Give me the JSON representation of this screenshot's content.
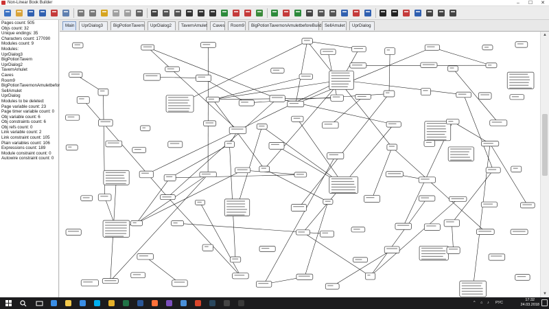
{
  "window": {
    "title": "Non-Linear Book Builder",
    "minimize": "–",
    "maximize": "☐",
    "close": "✕"
  },
  "toolbar": {
    "buttons": [
      {
        "name": "new-project-button",
        "icon": "new-page-icon",
        "color": "#3c73c4"
      },
      {
        "name": "open-project-button",
        "icon": "open-folder-icon",
        "color": "#d9a43b"
      },
      {
        "name": "save-button",
        "icon": "floppy-icon",
        "color": "#3060b0"
      },
      {
        "name": "save-as-button",
        "icon": "floppy-pen-icon",
        "color": "#3060b0"
      },
      {
        "name": "export-button",
        "icon": "grid-export-icon",
        "color": "#c43a3a"
      },
      {
        "name": "close-project-button",
        "icon": "close-doc-icon",
        "color": "#6080b0"
      },
      {
        "name": "undo-button",
        "icon": "undo-icon",
        "color": "#7a7a7a"
      },
      {
        "name": "redo-button",
        "icon": "redo-icon",
        "color": "#7a7a7a"
      },
      {
        "name": "cut-button",
        "icon": "cut-icon",
        "color": "#d6a41f"
      },
      {
        "name": "copy-button",
        "icon": "copy-icon",
        "color": "#a0a0a0"
      },
      {
        "name": "paste-button",
        "icon": "paste-icon",
        "color": "#a0a0a0"
      },
      {
        "name": "clipboard-button",
        "icon": "clipboard-icon",
        "color": "#666"
      },
      {
        "name": "link-button",
        "icon": "link-icon",
        "color": "#444"
      },
      {
        "name": "page-button",
        "icon": "page-icon",
        "color": "#555"
      },
      {
        "name": "folder-up-button",
        "icon": "folder-up-icon",
        "color": "#555"
      },
      {
        "name": "arrow-tool-button",
        "icon": "arrow-down-right-icon",
        "color": "#333"
      },
      {
        "name": "select-tool-button",
        "icon": "square-icon",
        "color": "#333"
      },
      {
        "name": "crop-button",
        "icon": "crop-icon",
        "color": "#333"
      },
      {
        "name": "edit-button",
        "icon": "pencil-icon",
        "color": "#2c8a3b"
      },
      {
        "name": "image-button",
        "icon": "image-icon",
        "color": "#c53a3a"
      },
      {
        "name": "delete-button",
        "icon": "delete-icon",
        "color": "#c53a3a"
      },
      {
        "name": "grid-button",
        "icon": "grid-icon",
        "color": "#3a8a3a"
      },
      {
        "name": "run-button",
        "icon": "run-icon",
        "color": "#2c8a3b"
      },
      {
        "name": "magnet-button",
        "icon": "magnet-icon",
        "color": "#c53a3a"
      },
      {
        "name": "check-button",
        "icon": "check-icon",
        "color": "#2c8a3b"
      },
      {
        "name": "window-button",
        "icon": "window-icon",
        "color": "#444"
      },
      {
        "name": "preview-button",
        "icon": "preview-icon",
        "color": "#555"
      },
      {
        "name": "layers-button",
        "icon": "layers-icon",
        "color": "#555"
      },
      {
        "name": "monitor-button",
        "icon": "monitor-icon",
        "color": "#3060b0"
      },
      {
        "name": "module-button",
        "icon": "module-icon",
        "color": "#c53a3a"
      },
      {
        "name": "module-save-button",
        "icon": "module-save-icon",
        "color": "#3060b0"
      },
      {
        "name": "print-button",
        "icon": "print-icon",
        "color": "#222"
      },
      {
        "name": "camera-button",
        "icon": "camera-icon",
        "color": "#222"
      },
      {
        "name": "settings-button",
        "icon": "settings-icon",
        "color": "#c53a3a"
      },
      {
        "name": "variables-button",
        "icon": "variables-icon",
        "color": "#3060b0"
      },
      {
        "name": "user-button",
        "icon": "user-settings-icon",
        "color": "#444"
      },
      {
        "name": "terminal-button",
        "icon": "terminal-icon",
        "color": "#444"
      },
      {
        "name": "text-button",
        "icon": "text-icon",
        "color": "#444"
      }
    ]
  },
  "info": {
    "lines": [
      "Pages count: 505",
      "Objs count: 32",
      "Unique endings: 35",
      "Characters count: 177090",
      "Modules count: 9",
      "Modules:",
      "UprDialog3",
      "BigPotionTavern",
      "UprDialog2",
      "TavernAmulet",
      "Caves",
      "Room9",
      "BigPotionTavernonAmuletbefore",
      "SellAmulet",
      "UprDialog",
      "Modules to be deleted:",
      "Page variable count: 23",
      "Page timer variable count: 0",
      "Obj variable count: 6",
      "Obj constraints count: 6",
      "Obj refs count: 0",
      "Link variable count: 2",
      "Link constraint count: 105",
      "Plain variables count: 106",
      "Expressions count: 189",
      "Module constraint count: 0",
      "Autowire constraint count: 0"
    ]
  },
  "tabs": [
    "Main",
    "UprDialog3",
    "BigPotionTavern",
    "UprDialog2",
    "TavernAmulet",
    "Caves",
    "Room9",
    "BigPotionTavernonAmuletbeforeBuild",
    "SellAmulet",
    "UprDialog"
  ],
  "active_tab": "Main",
  "scroll": {
    "up": "▲",
    "down": "▼"
  },
  "taskbar": {
    "apps": [
      {
        "name": "start-button",
        "icon": "windows-icon",
        "color": "#ffffff"
      },
      {
        "name": "search-taskbar",
        "icon": "search-icon",
        "color": "#ffffff"
      },
      {
        "name": "task-view-button",
        "icon": "task-view-icon",
        "color": "#ffffff"
      },
      {
        "name": "edge-app",
        "icon": "edge-icon",
        "color": "#3a8ee6"
      },
      {
        "name": "explorer-app",
        "icon": "folder-icon",
        "color": "#f2c94c"
      },
      {
        "name": "store-app",
        "icon": "store-icon",
        "color": "#3a8ee6"
      },
      {
        "name": "skype-app",
        "icon": "skype-icon",
        "color": "#00aff0"
      },
      {
        "name": "chrome-app",
        "icon": "chrome-icon",
        "color": "#e5b12a"
      },
      {
        "name": "excel-app",
        "icon": "excel-icon",
        "color": "#217346"
      },
      {
        "name": "word-app",
        "icon": "word-icon",
        "color": "#2b5797"
      },
      {
        "name": "firefox-app",
        "icon": "firefox-icon",
        "color": "#ff7139"
      },
      {
        "name": "visual-studio-app",
        "icon": "visual-studio-icon",
        "color": "#7b4fbd"
      },
      {
        "name": "app-blue",
        "icon": "app-icon",
        "color": "#4a90d9"
      },
      {
        "name": "java-app",
        "icon": "java-icon",
        "color": "#d9452b"
      },
      {
        "name": "steam-app",
        "icon": "steam-icon",
        "color": "#2a475e"
      },
      {
        "name": "terminal-app",
        "icon": "terminal-icon",
        "color": "#444"
      },
      {
        "name": "app-dark",
        "icon": "app-icon",
        "color": "#3a3a3a"
      }
    ],
    "tray": [
      "^",
      "⌂",
      "♪",
      "РУС"
    ],
    "time": "17:32",
    "date": "24.03.2018"
  }
}
